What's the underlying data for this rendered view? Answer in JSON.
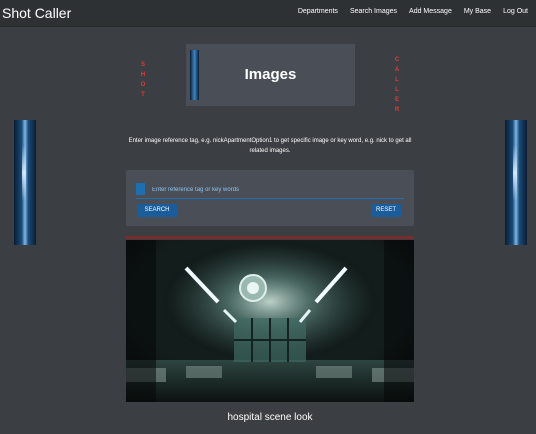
{
  "navbar": {
    "brand": "Shot Caller",
    "links": [
      "Departments",
      "Search Images",
      "Add Message",
      "My Base",
      "Log Out"
    ]
  },
  "side_words": {
    "left": [
      "S",
      "H",
      "O",
      "T"
    ],
    "right": [
      "C",
      "A",
      "L",
      "L",
      "E",
      "R"
    ]
  },
  "header": {
    "title": "Images"
  },
  "search": {
    "description": "Enter image reference tag, e.g. nickApartmentOption1 to get specific image or key word, e.g. nick to get all related images.",
    "placeholder": "Enter reference tag or key words",
    "search_label": "SEARCH",
    "reset_label": "RESET"
  },
  "result": {
    "caption": "hospital scene look"
  },
  "colors": {
    "accent": "#1b5d9a",
    "vertical_word": "#e03a3a",
    "background": "#3b3e42"
  }
}
